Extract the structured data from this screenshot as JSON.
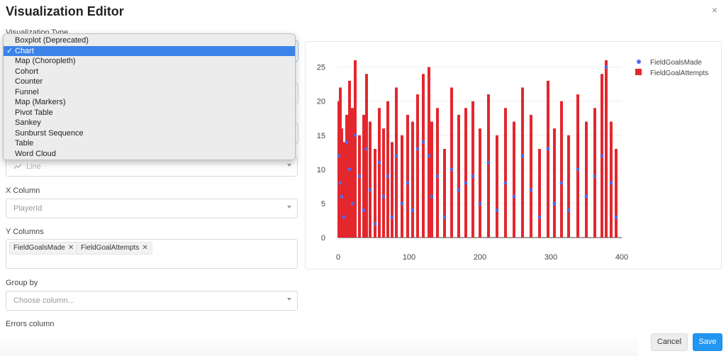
{
  "title": "Visualization Editor",
  "close_icon_text": "×",
  "visualization_type_label": "Visualization Type",
  "dropdown": {
    "options": [
      "Boxplot (Deprecated)",
      "Chart",
      "Map (Choropleth)",
      "Cohort",
      "Counter",
      "Funnel",
      "Map (Markers)",
      "Pivot Table",
      "Sankey",
      "Sunburst Sequence",
      "Table",
      "Word Cloud"
    ],
    "selected": "Chart",
    "check": "✓"
  },
  "chart_type": {
    "value": "Line"
  },
  "x_column": {
    "label": "X Column",
    "value": "PlayerId"
  },
  "y_columns": {
    "label": "Y Columns",
    "tags": [
      "FieldGoalsMade",
      "FieldGoalAttempts"
    ],
    "remove_icon": "✕"
  },
  "group_by": {
    "label": "Group by",
    "placeholder": "Choose column..."
  },
  "errors_column": {
    "label": "Errors column"
  },
  "buttons": {
    "cancel": "Cancel",
    "save": "Save"
  },
  "colors": {
    "made": "#4f6bed",
    "attempts": "#e3272d",
    "primary": "#2196f3",
    "selected_option": "#3b83e8"
  },
  "chart_data": {
    "type": "bar",
    "xlim": [
      0,
      400
    ],
    "ylim": [
      0,
      26
    ],
    "xticks": [
      0,
      100,
      200,
      300,
      400
    ],
    "yticks": [
      0,
      5,
      10,
      15,
      20,
      25
    ],
    "grid": true,
    "legend_position": "top-right",
    "series": [
      {
        "name": "FieldGoalsMade",
        "style": "markers",
        "x": [
          1,
          3,
          5,
          8,
          12,
          16,
          20,
          24,
          30,
          36,
          40,
          45,
          52,
          58,
          64,
          70,
          76,
          82,
          90,
          98,
          105,
          112,
          120,
          128,
          132,
          140,
          150,
          160,
          170,
          180,
          190,
          200,
          212,
          224,
          236,
          248,
          260,
          272,
          284,
          296,
          305,
          315,
          325,
          338,
          350,
          362,
          372,
          378,
          385,
          392
        ],
        "y": [
          12,
          8,
          6,
          3,
          14,
          10,
          5,
          15,
          9,
          4,
          13,
          7,
          2,
          11,
          6,
          9,
          3,
          12,
          5,
          8,
          4,
          13,
          14,
          12,
          6,
          9,
          3,
          10,
          7,
          8,
          9,
          5,
          11,
          4,
          8,
          6,
          12,
          7,
          3,
          13,
          5,
          8,
          4,
          10,
          6,
          9,
          12,
          25,
          8,
          3
        ]
      },
      {
        "name": "FieldGoalAttempts",
        "style": "bars",
        "x": [
          1,
          3,
          5,
          8,
          12,
          16,
          20,
          24,
          30,
          36,
          40,
          45,
          52,
          58,
          64,
          70,
          76,
          82,
          90,
          98,
          105,
          112,
          120,
          128,
          132,
          140,
          150,
          160,
          170,
          180,
          190,
          200,
          212,
          224,
          236,
          248,
          260,
          272,
          284,
          296,
          305,
          315,
          325,
          338,
          350,
          362,
          372,
          378,
          385,
          392
        ],
        "y": [
          20,
          22,
          16,
          14,
          18,
          23,
          19,
          26,
          15,
          18,
          24,
          17,
          13,
          19,
          16,
          20,
          14,
          22,
          15,
          18,
          17,
          21,
          24,
          25,
          17,
          19,
          13,
          22,
          18,
          19,
          20,
          16,
          21,
          15,
          19,
          17,
          22,
          18,
          13,
          23,
          16,
          20,
          15,
          21,
          17,
          19,
          24,
          26,
          17,
          13
        ]
      }
    ]
  }
}
